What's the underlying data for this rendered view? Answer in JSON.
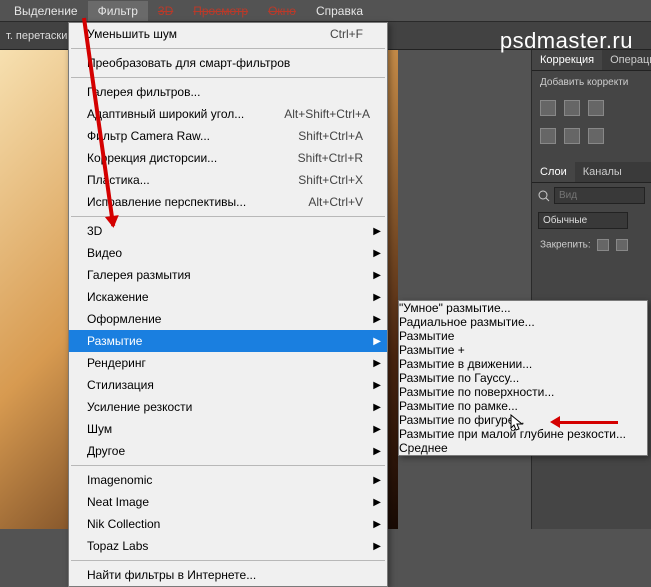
{
  "menubar": {
    "items": [
      "Выделение",
      "Фильтр",
      "3D",
      "Просмотр",
      "Окно",
      "Справка"
    ],
    "strike_start": 2
  },
  "toolbar": {
    "hint": "т. перетаскива"
  },
  "brand": "psdmaster.ru",
  "filter_menu": {
    "last": {
      "label": "Уменьшить шум",
      "shortcut": "Ctrl+F"
    },
    "smart": "Преобразовать для смарт-фильтров",
    "group1": [
      {
        "label": "Галерея фильтров..."
      },
      {
        "label": "Адаптивный широкий угол...",
        "shortcut": "Alt+Shift+Ctrl+A"
      },
      {
        "label": "Фильтр Camera Raw...",
        "shortcut": "Shift+Ctrl+A"
      },
      {
        "label": "Коррекция дисторсии...",
        "shortcut": "Shift+Ctrl+R"
      },
      {
        "label": "Пластика...",
        "shortcut": "Shift+Ctrl+X"
      },
      {
        "label": "Исправление перспективы...",
        "shortcut": "Alt+Ctrl+V"
      }
    ],
    "group2": [
      "3D",
      "Видео",
      "Галерея размытия",
      "Искажение",
      "Оформление",
      "Размытие",
      "Рендеринг",
      "Стилизация",
      "Усиление резкости",
      "Шум",
      "Другое"
    ],
    "selected_index": 5,
    "group3": [
      "Imagenomic",
      "Neat Image",
      "Nik Collection",
      "Topaz Labs"
    ],
    "find": "Найти фильтры в Интернете..."
  },
  "blur_submenu": {
    "items": [
      "\"Умное\" размытие...",
      "Радиальное размытие...",
      "Размытие",
      "Размытие +",
      "Размытие в движении...",
      "Размытие по Гауссу...",
      "Размытие по поверхности...",
      "Размытие по рамке...",
      "Размытие по фигуре...",
      "Размытие при малой глубине резкости...",
      "Среднее"
    ],
    "selected_index": 6
  },
  "panels": {
    "corr_tab1": "Коррекция",
    "corr_tab2": "Операци",
    "corr_hint": "Добавить корректи",
    "layers_tab1": "Слои",
    "layers_tab2": "Каналы",
    "search_placeholder": "Вид",
    "blend": "Обычные",
    "lock_label": "Закрепить:"
  }
}
